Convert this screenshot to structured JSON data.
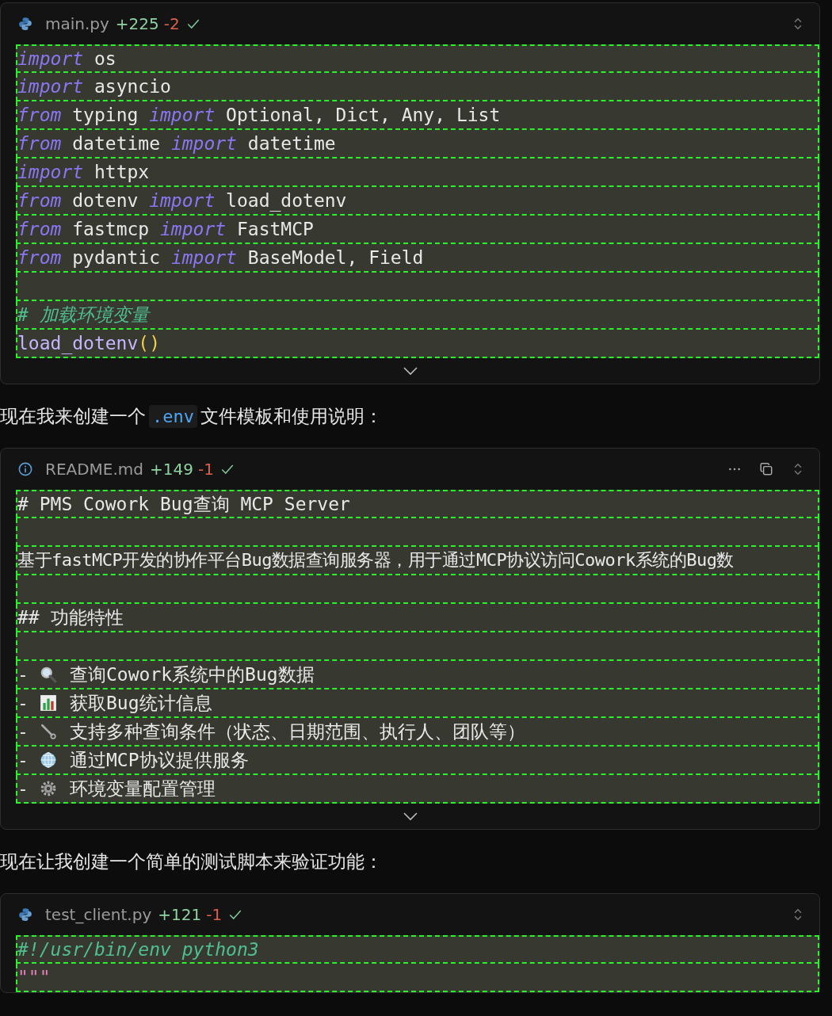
{
  "blocks": [
    {
      "kind": "python",
      "filename": "main.py",
      "added": "+225",
      "removed": "-2",
      "hovered": false,
      "collapsed": true,
      "lines": [
        {
          "kind": "code",
          "tokens": [
            {
              "kind": "kw",
              "text": "import"
            },
            {
              "kind": "plain",
              "text": " os"
            }
          ]
        },
        {
          "kind": "code",
          "tokens": [
            {
              "kind": "kw",
              "text": "import"
            },
            {
              "kind": "plain",
              "text": " asyncio"
            }
          ]
        },
        {
          "kind": "code",
          "tokens": [
            {
              "kind": "kw",
              "text": "from"
            },
            {
              "kind": "plain",
              "text": " typing "
            },
            {
              "kind": "kw",
              "text": "import"
            },
            {
              "kind": "plain",
              "text": " Optional, Dict, Any, List"
            }
          ]
        },
        {
          "kind": "code",
          "tokens": [
            {
              "kind": "kw",
              "text": "from"
            },
            {
              "kind": "plain",
              "text": " datetime "
            },
            {
              "kind": "kw",
              "text": "import"
            },
            {
              "kind": "plain",
              "text": " datetime"
            }
          ]
        },
        {
          "kind": "code",
          "tokens": [
            {
              "kind": "kw",
              "text": "import"
            },
            {
              "kind": "plain",
              "text": " httpx"
            }
          ]
        },
        {
          "kind": "code",
          "tokens": [
            {
              "kind": "kw",
              "text": "from"
            },
            {
              "kind": "plain",
              "text": " dotenv "
            },
            {
              "kind": "kw",
              "text": "import"
            },
            {
              "kind": "plain",
              "text": " load_dotenv"
            }
          ]
        },
        {
          "kind": "code",
          "tokens": [
            {
              "kind": "kw",
              "text": "from"
            },
            {
              "kind": "plain",
              "text": " fastmcp "
            },
            {
              "kind": "kw",
              "text": "import"
            },
            {
              "kind": "plain",
              "text": " FastMCP"
            }
          ]
        },
        {
          "kind": "code",
          "tokens": [
            {
              "kind": "kw",
              "text": "from"
            },
            {
              "kind": "plain",
              "text": " pydantic "
            },
            {
              "kind": "kw",
              "text": "import"
            },
            {
              "kind": "plain",
              "text": " BaseModel, Field"
            }
          ]
        },
        {
          "kind": "blank"
        },
        {
          "kind": "code",
          "tokens": [
            {
              "kind": "comment",
              "text": "# 加载环境变量"
            }
          ]
        },
        {
          "kind": "code",
          "tokens": [
            {
              "kind": "fn",
              "text": "load_dotenv"
            },
            {
              "kind": "paren",
              "text": "()"
            }
          ]
        }
      ]
    },
    {
      "kind": "text",
      "before": "现在我来创建一个",
      "code": ".env",
      "after": "文件模板和使用说明："
    },
    {
      "kind": "markdown",
      "filename": "README.md",
      "added": "+149",
      "removed": "-1",
      "hovered": true,
      "collapsed": true,
      "lines": [
        {
          "kind": "code",
          "tokens": [
            {
              "kind": "plain",
              "text": "# PMS Cowork Bug查询 MCP Server"
            }
          ]
        },
        {
          "kind": "blank"
        },
        {
          "kind": "code",
          "tokens": [
            {
              "kind": "prose",
              "text": "基于fastMCP开发的协作平台Bug数据查询服务器，用于通过MCP协议访问Cowork系统的Bug数"
            }
          ]
        },
        {
          "kind": "blank"
        },
        {
          "kind": "code",
          "tokens": [
            {
              "kind": "plain",
              "text": "## 功能特性"
            }
          ]
        },
        {
          "kind": "blank"
        },
        {
          "kind": "list",
          "bullet": "-",
          "text": "查询Cowork系统中的Bug数据"
        },
        {
          "kind": "list",
          "bullet": "-",
          "text": "获取Bug统计信息"
        },
        {
          "kind": "list",
          "bullet": "-",
          "text": "支持多种查询条件（状态、日期范围、执行人、团队等）"
        },
        {
          "kind": "list",
          "bullet": "-",
          "text": "通过MCP协议提供服务"
        },
        {
          "kind": "list",
          "bullet": "-",
          "text": "环境变量配置管理"
        }
      ]
    },
    {
      "kind": "text",
      "before": "现在让我创建一个简单的测试脚本来验证功能："
    },
    {
      "kind": "python",
      "filename": "test_client.py",
      "added": "+121",
      "removed": "-1",
      "hovered": false,
      "collapsed": false,
      "lines": [
        {
          "kind": "code",
          "tokens": [
            {
              "kind": "comment",
              "text": "#!/usr/bin/env python3"
            }
          ]
        },
        {
          "kind": "code",
          "tokens": [
            {
              "kind": "string",
              "text": "\"\"\""
            }
          ]
        }
      ]
    }
  ]
}
